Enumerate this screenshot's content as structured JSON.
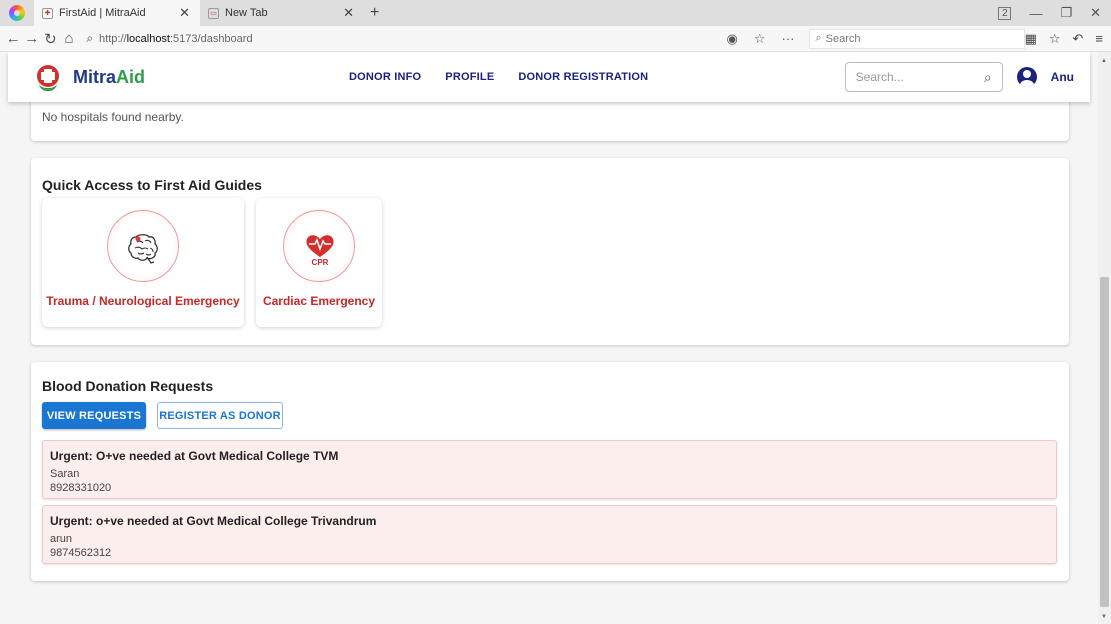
{
  "browser": {
    "tabs": [
      {
        "title": "FirstAid | MitraAid",
        "active": true
      },
      {
        "title": "New Tab",
        "active": false
      }
    ],
    "url_prefix": "http://",
    "url_host": "localhost",
    "url_path": ":5173/dashboard",
    "search_placeholder": "Search",
    "tab_count": "2"
  },
  "header": {
    "brand_main": "Mitra",
    "brand_accent": "Aid",
    "menu": [
      "DONOR INFO",
      "PROFILE",
      "DONOR REGISTRATION"
    ],
    "search_placeholder": "Search...",
    "username": "Anu"
  },
  "nearby": {
    "message": "No hospitals found nearby."
  },
  "guides": {
    "title": "Quick Access to First Aid Guides",
    "items": [
      {
        "label": "Trauma / Neurological Emergency",
        "icon": "brain-icon"
      },
      {
        "label": "Cardiac Emergency",
        "icon": "heart-cpr-icon",
        "icon_text": "CPR"
      }
    ]
  },
  "blood": {
    "title": "Blood Donation Requests",
    "view_label": "VIEW REQUESTS",
    "register_label": "REGISTER AS DONOR",
    "requests": [
      {
        "title": "Urgent: O+ve needed at Govt Medical College TVM",
        "name": "Saran",
        "phone": "8928331020"
      },
      {
        "title": "Urgent: o+ve needed at Govt Medical College Trivandrum",
        "name": "arun",
        "phone": "9874562312"
      }
    ]
  },
  "colors": {
    "primary": "#1976d2",
    "brand_blue": "#1e3a8a",
    "brand_green": "#2e9e4a",
    "emergency_red": "#c62828",
    "request_bg": "#fdeeee"
  }
}
